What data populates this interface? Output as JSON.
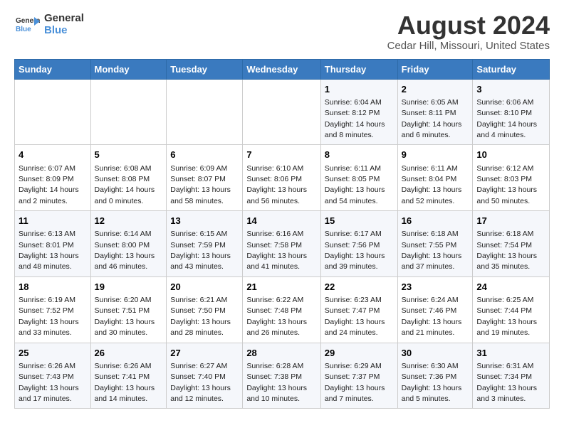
{
  "logo": {
    "line1": "General",
    "line2": "Blue"
  },
  "title": "August 2024",
  "subtitle": "Cedar Hill, Missouri, United States",
  "days_of_week": [
    "Sunday",
    "Monday",
    "Tuesday",
    "Wednesday",
    "Thursday",
    "Friday",
    "Saturday"
  ],
  "weeks": [
    [
      {
        "day": "",
        "info": ""
      },
      {
        "day": "",
        "info": ""
      },
      {
        "day": "",
        "info": ""
      },
      {
        "day": "",
        "info": ""
      },
      {
        "day": "1",
        "info": "Sunrise: 6:04 AM\nSunset: 8:12 PM\nDaylight: 14 hours\nand 8 minutes."
      },
      {
        "day": "2",
        "info": "Sunrise: 6:05 AM\nSunset: 8:11 PM\nDaylight: 14 hours\nand 6 minutes."
      },
      {
        "day": "3",
        "info": "Sunrise: 6:06 AM\nSunset: 8:10 PM\nDaylight: 14 hours\nand 4 minutes."
      }
    ],
    [
      {
        "day": "4",
        "info": "Sunrise: 6:07 AM\nSunset: 8:09 PM\nDaylight: 14 hours\nand 2 minutes."
      },
      {
        "day": "5",
        "info": "Sunrise: 6:08 AM\nSunset: 8:08 PM\nDaylight: 14 hours\nand 0 minutes."
      },
      {
        "day": "6",
        "info": "Sunrise: 6:09 AM\nSunset: 8:07 PM\nDaylight: 13 hours\nand 58 minutes."
      },
      {
        "day": "7",
        "info": "Sunrise: 6:10 AM\nSunset: 8:06 PM\nDaylight: 13 hours\nand 56 minutes."
      },
      {
        "day": "8",
        "info": "Sunrise: 6:11 AM\nSunset: 8:05 PM\nDaylight: 13 hours\nand 54 minutes."
      },
      {
        "day": "9",
        "info": "Sunrise: 6:11 AM\nSunset: 8:04 PM\nDaylight: 13 hours\nand 52 minutes."
      },
      {
        "day": "10",
        "info": "Sunrise: 6:12 AM\nSunset: 8:03 PM\nDaylight: 13 hours\nand 50 minutes."
      }
    ],
    [
      {
        "day": "11",
        "info": "Sunrise: 6:13 AM\nSunset: 8:01 PM\nDaylight: 13 hours\nand 48 minutes."
      },
      {
        "day": "12",
        "info": "Sunrise: 6:14 AM\nSunset: 8:00 PM\nDaylight: 13 hours\nand 46 minutes."
      },
      {
        "day": "13",
        "info": "Sunrise: 6:15 AM\nSunset: 7:59 PM\nDaylight: 13 hours\nand 43 minutes."
      },
      {
        "day": "14",
        "info": "Sunrise: 6:16 AM\nSunset: 7:58 PM\nDaylight: 13 hours\nand 41 minutes."
      },
      {
        "day": "15",
        "info": "Sunrise: 6:17 AM\nSunset: 7:56 PM\nDaylight: 13 hours\nand 39 minutes."
      },
      {
        "day": "16",
        "info": "Sunrise: 6:18 AM\nSunset: 7:55 PM\nDaylight: 13 hours\nand 37 minutes."
      },
      {
        "day": "17",
        "info": "Sunrise: 6:18 AM\nSunset: 7:54 PM\nDaylight: 13 hours\nand 35 minutes."
      }
    ],
    [
      {
        "day": "18",
        "info": "Sunrise: 6:19 AM\nSunset: 7:52 PM\nDaylight: 13 hours\nand 33 minutes."
      },
      {
        "day": "19",
        "info": "Sunrise: 6:20 AM\nSunset: 7:51 PM\nDaylight: 13 hours\nand 30 minutes."
      },
      {
        "day": "20",
        "info": "Sunrise: 6:21 AM\nSunset: 7:50 PM\nDaylight: 13 hours\nand 28 minutes."
      },
      {
        "day": "21",
        "info": "Sunrise: 6:22 AM\nSunset: 7:48 PM\nDaylight: 13 hours\nand 26 minutes."
      },
      {
        "day": "22",
        "info": "Sunrise: 6:23 AM\nSunset: 7:47 PM\nDaylight: 13 hours\nand 24 minutes."
      },
      {
        "day": "23",
        "info": "Sunrise: 6:24 AM\nSunset: 7:46 PM\nDaylight: 13 hours\nand 21 minutes."
      },
      {
        "day": "24",
        "info": "Sunrise: 6:25 AM\nSunset: 7:44 PM\nDaylight: 13 hours\nand 19 minutes."
      }
    ],
    [
      {
        "day": "25",
        "info": "Sunrise: 6:26 AM\nSunset: 7:43 PM\nDaylight: 13 hours\nand 17 minutes."
      },
      {
        "day": "26",
        "info": "Sunrise: 6:26 AM\nSunset: 7:41 PM\nDaylight: 13 hours\nand 14 minutes."
      },
      {
        "day": "27",
        "info": "Sunrise: 6:27 AM\nSunset: 7:40 PM\nDaylight: 13 hours\nand 12 minutes."
      },
      {
        "day": "28",
        "info": "Sunrise: 6:28 AM\nSunset: 7:38 PM\nDaylight: 13 hours\nand 10 minutes."
      },
      {
        "day": "29",
        "info": "Sunrise: 6:29 AM\nSunset: 7:37 PM\nDaylight: 13 hours\nand 7 minutes."
      },
      {
        "day": "30",
        "info": "Sunrise: 6:30 AM\nSunset: 7:36 PM\nDaylight: 13 hours\nand 5 minutes."
      },
      {
        "day": "31",
        "info": "Sunrise: 6:31 AM\nSunset: 7:34 PM\nDaylight: 13 hours\nand 3 minutes."
      }
    ]
  ]
}
